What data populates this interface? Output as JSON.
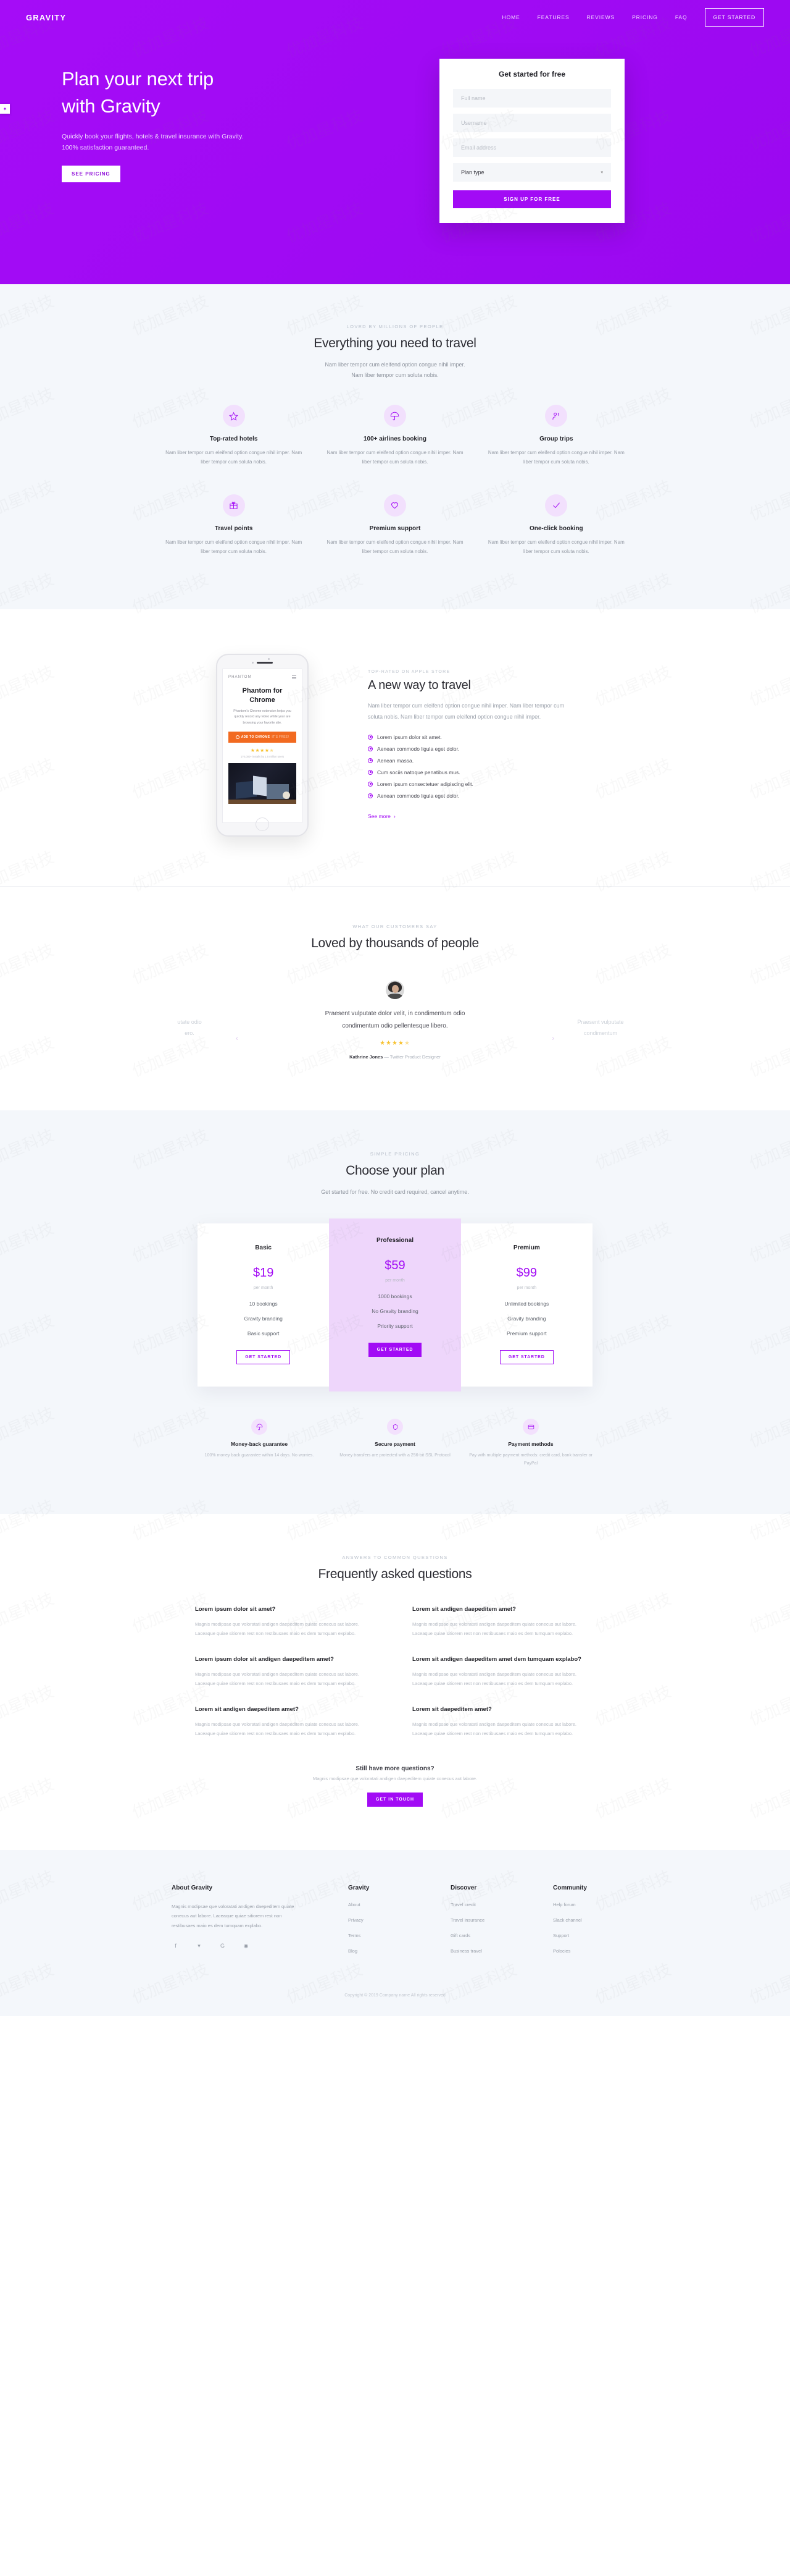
{
  "brand": {
    "logo": "GRAVITY",
    "accent": "#a20bf5",
    "light_accent": "#eed6fb"
  },
  "nav": {
    "links": [
      {
        "label": "HOME"
      },
      {
        "label": "FEATURES"
      },
      {
        "label": "REVIEWS"
      },
      {
        "label": "PRICING"
      },
      {
        "label": "FAQ"
      }
    ],
    "cta": "GET STARTED"
  },
  "hero": {
    "title_line1": "Plan your next trip",
    "title_line2": "with Gravity",
    "subtitle": "Quickly book your flights, hotels & travel insurance with Gravity. 100% satisfaction guaranteed.",
    "button": "SEE PRICING",
    "side_tab_icon": "chat-icon"
  },
  "signup": {
    "title": "Get started for free",
    "fullname_placeholder": "Full name",
    "username_placeholder": "Username",
    "email_placeholder": "Email address",
    "plan_label": "Plan type",
    "submit": "SIGN UP FOR FREE"
  },
  "features": {
    "eyebrow": "LOVED BY MILLIONS OF PEOPLE",
    "title": "Everything you need to travel",
    "lead_line1": "Nam liber tempor cum eleifend option congue nihil imper.",
    "lead_line2": "Nam liber tempor cum soluta nobis.",
    "body": "Nam liber tempor cum eleifend option congue nihil imper. Nam liber tempor cum soluta nobis.",
    "items": [
      {
        "icon": "star-icon",
        "title": "Top-rated hotels"
      },
      {
        "icon": "umbrella-icon",
        "title": "100+ airlines booking"
      },
      {
        "icon": "users-icon",
        "title": "Group trips"
      },
      {
        "icon": "gift-icon",
        "title": "Travel points"
      },
      {
        "icon": "heart-icon",
        "title": "Premium support"
      },
      {
        "icon": "check-icon",
        "title": "One-click booking"
      }
    ]
  },
  "phone": {
    "brand": "PHANTOM",
    "title_line1": "Phantom for",
    "title_line2": "Chrome",
    "text": "Phantom's Chrome extension helps you quickly record any video while your are browsing your favorite site.",
    "button": "ADD TO CHROME",
    "button_note": "IT'S FREE!",
    "stars": "★★★★",
    "half_star": "★",
    "rating_note": "170,000+ installs by 1.5 million users"
  },
  "app": {
    "eyebrow": "TOP-RATED ON APPLE STORE",
    "title": "A new way to travel",
    "text": "Nam liber tempor cum eleifend option congue nihil imper. Nam liber tempor cum soluta nobis. Nam liber tempor cum eleifend option congue nihil imper.",
    "list": [
      "Lorem ipsum dolor sit amet.",
      "Aenean commodo ligula eget dolor.",
      "Aenean massa.",
      "Cum sociis natoque penatibus mus.",
      "Lorem ipsum consectetuer adipiscing elit.",
      "Aenean commodo ligula eget dolor."
    ],
    "see_more": "See more"
  },
  "testimonials": {
    "eyebrow": "WHAT OUR CUSTOMERS SAY",
    "title": "Loved by thousands of people",
    "quote_line1": "Praesent vulputate dolor velit, in condimentum odio",
    "quote_line2": "condimentum odio pellentesque libero.",
    "stars": "★★★★",
    "half_star": "★",
    "author_name": "Kathrine Jones",
    "author_role": "— Twitter Product Designer",
    "prev_partial_line1": "utate odio",
    "prev_partial_line2": "ero.",
    "next_partial_line1": "Praesent vulputate",
    "next_partial_line2": "condimentum",
    "prev_arrow": "‹",
    "next_arrow": "›"
  },
  "pricing": {
    "eyebrow": "SIMPLE PRICING",
    "title": "Choose your plan",
    "lead": "Get started for free. No credit card required, cancel anytime.",
    "per_month": "per month",
    "cta": "GET STARTED",
    "plans": [
      {
        "name": "Basic",
        "price": "$19",
        "featured": false,
        "features": [
          "10 bookings",
          "Gravity branding",
          "Basic support"
        ]
      },
      {
        "name": "Professional",
        "price": "$59",
        "featured": true,
        "features": [
          "1000 bookings",
          "No Gravity branding",
          "Priority support"
        ]
      },
      {
        "name": "Premium",
        "price": "$99",
        "featured": false,
        "features": [
          "Unlimited bookings",
          "Gravity branding",
          "Premium support"
        ]
      }
    ],
    "badges": [
      {
        "icon": "umbrella-icon",
        "title": "Money-back guarantee",
        "text": "100% money back guarantee within 14 days. No worries."
      },
      {
        "icon": "shield-icon",
        "title": "Secure payment",
        "text": "Money transfers are protected with a 256-bit SSL Protocol"
      },
      {
        "icon": "card-icon",
        "title": "Payment methods",
        "text": "Pay with multiple payment methods: credit card, bank transfer or PayPal"
      }
    ]
  },
  "faq": {
    "eyebrow": "ANSWERS TO COMMON QUESTIONS",
    "title": "Frequently asked questions",
    "answer": "Magnis modipsae que voloratati andigen daepeditem quiate conecus aut labore. Laceaque quiae sitiorem rest non restibusaes maio es dem tumquam explabo.",
    "items": [
      {
        "q": "Lorem ipsum dolor sit amet?"
      },
      {
        "q": "Lorem sit andigen daepeditem amet?"
      },
      {
        "q": "Lorem ipsum dolor sit andigen daepeditem amet?"
      },
      {
        "q": "Lorem sit andigen daepeditem amet dem tumquam explabo?"
      },
      {
        "q": "Lorem sit andigen daepeditem amet?"
      },
      {
        "q": "Lorem sit daepeditem amet?"
      }
    ],
    "foot_title": "Still have more questions?",
    "foot_text": "Magnis modipsae que voloratati andigen daepeditem quiate conecus aut labore.",
    "foot_button": "GET IN TOUCH"
  },
  "footer": {
    "about_title": "About Gravity",
    "about_text": "Magnis modipsae que voloratati andigen daepeditem quiate conecus aut labore. Laceaque quiae sitiorem rest non restibusaes maio es dem tumquam explabo.",
    "socials": [
      {
        "icon": "facebook-icon",
        "glyph": "f"
      },
      {
        "icon": "twitter-icon",
        "glyph": "▾"
      },
      {
        "icon": "google-plus-icon",
        "glyph": "G"
      },
      {
        "icon": "dribbble-icon",
        "glyph": "◉"
      }
    ],
    "columns": [
      {
        "title": "Gravity",
        "links": [
          "About",
          "Privacy",
          "Terms",
          "Blog"
        ]
      },
      {
        "title": "Discover",
        "links": [
          "Travel credit",
          "Travel insurance",
          "Gift cards",
          "Business travel"
        ]
      },
      {
        "title": "Community",
        "links": [
          "Help forum",
          "Slack channel",
          "Support",
          "Polocies"
        ]
      }
    ],
    "copyright": "Copyright © 2019 Company name All rights reserved"
  },
  "watermark": "优加星科技"
}
